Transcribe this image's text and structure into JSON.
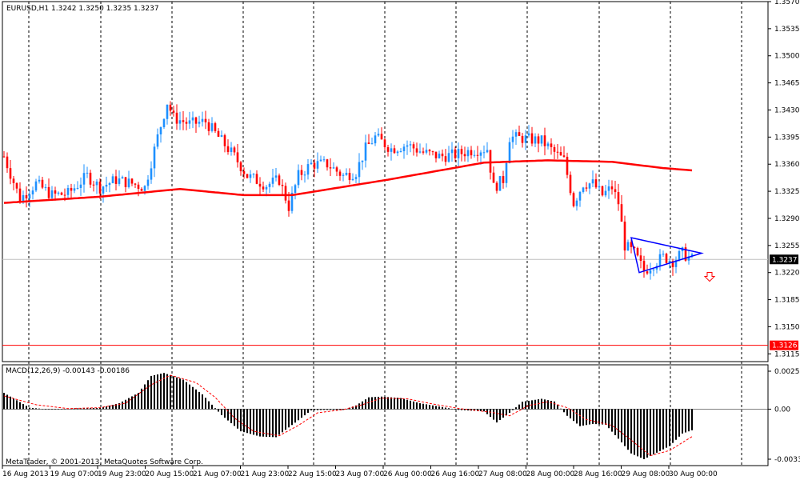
{
  "header": {
    "symbol": "EURUSD,H1",
    "ohlc": "1.3242 1.3250 1.3235 1.3237"
  },
  "macd": {
    "label": "MACD(12,26,9) -0.00143 -0.00186",
    "axis_ticks": [
      {
        "value": 0.00257,
        "label": "0.00257"
      },
      {
        "value": 0.0,
        "label": "0.00"
      },
      {
        "value": -0.00339,
        "label": "-0.00339"
      }
    ]
  },
  "copyright": "MetaTrader, © 2001-2013, MetaQuotes Software Corp.",
  "colors": {
    "background": "#ffffff",
    "grid": "#000000",
    "bull": "#1e90ff",
    "bear": "#ff0000",
    "ma": "#ff0000",
    "triangle": "#0000ff",
    "support": "#ff0000",
    "price_line": "#c0c0c0",
    "macd_hist": "#000000",
    "macd_signal": "#ff0000"
  },
  "chart_data": {
    "type": "candlestick",
    "symbol": "EURUSD",
    "timeframe": "H1",
    "ylim": [
      1.3105,
      1.357
    ],
    "y_ticks": [
      "1.3570",
      "1.3535",
      "1.3500",
      "1.3465",
      "1.3430",
      "1.3395",
      "1.3360",
      "1.3325",
      "1.3290",
      "1.3255",
      "1.3220",
      "1.3185",
      "1.3150",
      "1.3115"
    ],
    "x_labels": [
      "16 Aug 2013",
      "19 Aug 07:00",
      "19 Aug 23:00",
      "20 Aug 15:00",
      "21 Aug 07:00",
      "21 Aug 23:00",
      "22 Aug 15:00",
      "23 Aug 07:00",
      "26 Aug 00:00",
      "26 Aug 16:00",
      "27 Aug 08:00",
      "28 Aug 00:00",
      "28 Aug 16:00",
      "29 Aug 08:00",
      "30 Aug 00:00"
    ],
    "current_price": {
      "value": 1.3237,
      "label": "1.3237"
    },
    "support_line": {
      "value": 1.3126,
      "label": "1.3126"
    },
    "price_anchors": [
      [
        0,
        1.337
      ],
      [
        5,
        1.3315
      ],
      [
        10,
        1.3335
      ],
      [
        15,
        1.332
      ],
      [
        20,
        1.3322
      ],
      [
        26,
        1.3345
      ],
      [
        30,
        1.333
      ],
      [
        35,
        1.334
      ],
      [
        40,
        1.3335
      ],
      [
        44,
        1.333
      ],
      [
        48,
        1.3395
      ],
      [
        51,
        1.344
      ],
      [
        53,
        1.342
      ],
      [
        58,
        1.3412
      ],
      [
        63,
        1.3415
      ],
      [
        68,
        1.339
      ],
      [
        72,
        1.337
      ],
      [
        76,
        1.3345
      ],
      [
        82,
        1.3333
      ],
      [
        86,
        1.334
      ],
      [
        89,
        1.3305
      ],
      [
        92,
        1.3345
      ],
      [
        96,
        1.336
      ],
      [
        101,
        1.336
      ],
      [
        106,
        1.3345
      ],
      [
        110,
        1.335
      ],
      [
        113,
        1.338
      ],
      [
        116,
        1.3395
      ],
      [
        121,
        1.338
      ],
      [
        126,
        1.3385
      ],
      [
        131,
        1.3375
      ],
      [
        136,
        1.337
      ],
      [
        141,
        1.3372
      ],
      [
        146,
        1.3378
      ],
      [
        151,
        1.338
      ],
      [
        153,
        1.333
      ],
      [
        156,
        1.334
      ],
      [
        158,
        1.3395
      ],
      [
        163,
        1.3393
      ],
      [
        168,
        1.339
      ],
      [
        172,
        1.3375
      ],
      [
        175,
        1.3365
      ],
      [
        178,
        1.331
      ],
      [
        181,
        1.3335
      ],
      [
        184,
        1.3335
      ],
      [
        187,
        1.332
      ],
      [
        190,
        1.333
      ],
      [
        192,
        1.331
      ],
      [
        194,
        1.3255
      ],
      [
        197,
        1.3245
      ],
      [
        200,
        1.3222
      ],
      [
        203,
        1.3232
      ],
      [
        206,
        1.324
      ],
      [
        209,
        1.3235
      ],
      [
        212,
        1.3245
      ],
      [
        215,
        1.3237
      ]
    ],
    "ma_anchors": [
      [
        0,
        1.331
      ],
      [
        30,
        1.3318
      ],
      [
        55,
        1.3328
      ],
      [
        75,
        1.332
      ],
      [
        90,
        1.332
      ],
      [
        120,
        1.334
      ],
      [
        150,
        1.3362
      ],
      [
        170,
        1.3365
      ],
      [
        190,
        1.3363
      ],
      [
        206,
        1.3355
      ],
      [
        215,
        1.3352
      ]
    ],
    "triangle": {
      "points": [
        [
          1.3265,
          0.8
        ],
        [
          1.3245,
          1.0
        ],
        [
          1.322,
          0.8
        ]
      ],
      "note": "apex at right"
    },
    "arrow_price": 1.3215,
    "macd": {
      "ylim": [
        -0.00339,
        0.00257
      ],
      "hist_anchors": [
        [
          0,
          0.0011
        ],
        [
          8,
          0.0001
        ],
        [
          14,
          -2e-05
        ],
        [
          22,
          5e-05
        ],
        [
          30,
          8e-05
        ],
        [
          36,
          0.0004
        ],
        [
          42,
          0.0011
        ],
        [
          46,
          0.00225
        ],
        [
          50,
          0.00245
        ],
        [
          56,
          0.002
        ],
        [
          62,
          0.001
        ],
        [
          68,
          -0.0004
        ],
        [
          74,
          -0.0015
        ],
        [
          80,
          -0.00185
        ],
        [
          85,
          -0.0019
        ],
        [
          88,
          -0.0014
        ],
        [
          92,
          -0.00075
        ],
        [
          96,
          -8e-05
        ],
        [
          100,
          -5e-05
        ],
        [
          106,
          -5e-05
        ],
        [
          110,
          0.00025
        ],
        [
          114,
          0.0008
        ],
        [
          118,
          0.00085
        ],
        [
          124,
          0.00075
        ],
        [
          130,
          0.0004
        ],
        [
          136,
          0.00018
        ],
        [
          142,
          -5e-05
        ],
        [
          150,
          -0.00015
        ],
        [
          154,
          -0.0009
        ],
        [
          158,
          -0.00025
        ],
        [
          162,
          0.0005
        ],
        [
          168,
          0.0007
        ],
        [
          172,
          0.00052
        ],
        [
          176,
          -0.00045
        ],
        [
          180,
          -0.00115
        ],
        [
          184,
          -0.001
        ],
        [
          188,
          -0.00105
        ],
        [
          192,
          -0.002
        ],
        [
          196,
          -0.003
        ],
        [
          200,
          -0.00339
        ],
        [
          204,
          -0.00295
        ],
        [
          208,
          -0.0025
        ],
        [
          212,
          -0.00165
        ],
        [
          215,
          -0.00143
        ]
      ],
      "signal_anchors": [
        [
          0,
          0.0009
        ],
        [
          10,
          0.0003
        ],
        [
          20,
          4e-05
        ],
        [
          30,
          0.0001
        ],
        [
          38,
          0.0004
        ],
        [
          46,
          0.00165
        ],
        [
          52,
          0.0023
        ],
        [
          60,
          0.0018
        ],
        [
          66,
          0.0008
        ],
        [
          72,
          -0.0006
        ],
        [
          78,
          -0.0015
        ],
        [
          86,
          -0.0018
        ],
        [
          92,
          -0.0011
        ],
        [
          98,
          -0.00025
        ],
        [
          106,
          -3e-05
        ],
        [
          112,
          0.0003
        ],
        [
          118,
          0.00075
        ],
        [
          126,
          0.0007
        ],
        [
          134,
          0.00035
        ],
        [
          142,
          5e-05
        ],
        [
          152,
          -0.0002
        ],
        [
          158,
          -0.00045
        ],
        [
          164,
          0.00025
        ],
        [
          170,
          0.0005
        ],
        [
          176,
          0.0001
        ],
        [
          182,
          -0.0007
        ],
        [
          190,
          -0.0011
        ],
        [
          196,
          -0.0021
        ],
        [
          202,
          -0.00315
        ],
        [
          208,
          -0.0028
        ],
        [
          215,
          -0.00186
        ]
      ]
    }
  }
}
